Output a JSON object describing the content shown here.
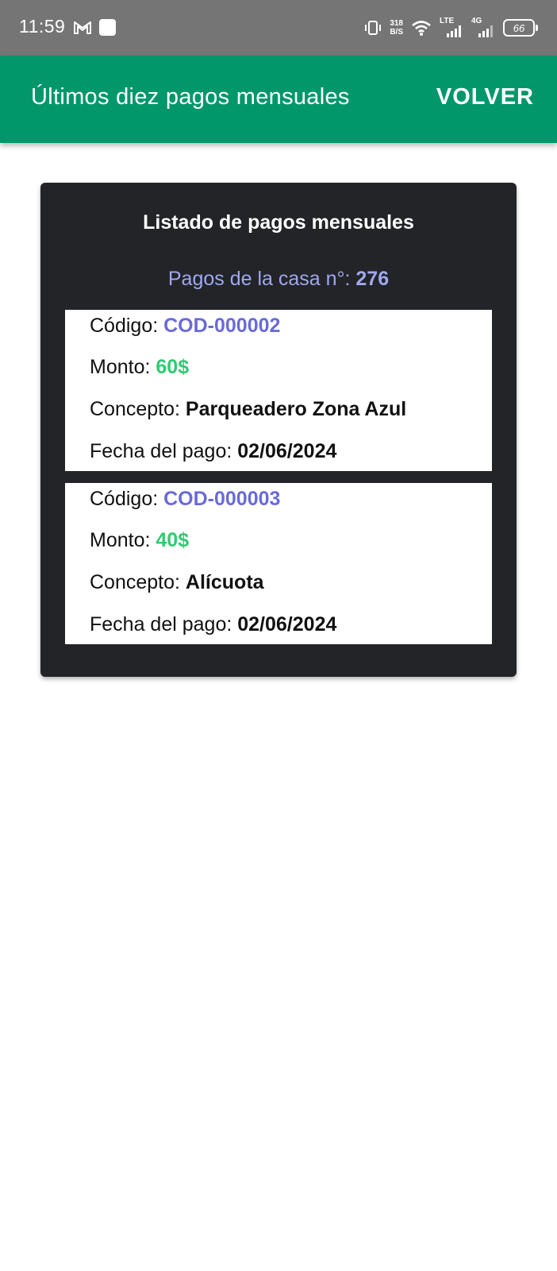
{
  "status_bar": {
    "time": "11:59",
    "net_speed_value": "318",
    "net_speed_unit": "B/S",
    "network_1": "LTE",
    "network_2": "4G",
    "battery": "66",
    "icons": [
      "gmail-icon",
      "notification-square-icon",
      "vibrate-icon",
      "wifi-icon",
      "signal-icon",
      "battery-icon"
    ]
  },
  "app_bar": {
    "title": "Últimos diez pagos mensuales",
    "back_label": "VOLVER",
    "color": "#02976a"
  },
  "card": {
    "title": "Listado de pagos mensuales",
    "house_label": "Pagos de la casa n°:",
    "house_number": "276",
    "background": "#232428"
  },
  "labels": {
    "code": "Código:",
    "amount": "Monto:",
    "concept": "Concepto:",
    "date": "Fecha del pago:"
  },
  "payments": [
    {
      "code": "COD-000002",
      "amount": "60$",
      "concept": "Parqueadero Zona Azul",
      "date": "02/06/2024"
    },
    {
      "code": "COD-000003",
      "amount": "40$",
      "concept": "Alícuota",
      "date": "02/06/2024"
    }
  ],
  "colors": {
    "code": "#6a6ad8",
    "amount": "#2ecc71",
    "subtitle": "#9fa8f0"
  }
}
